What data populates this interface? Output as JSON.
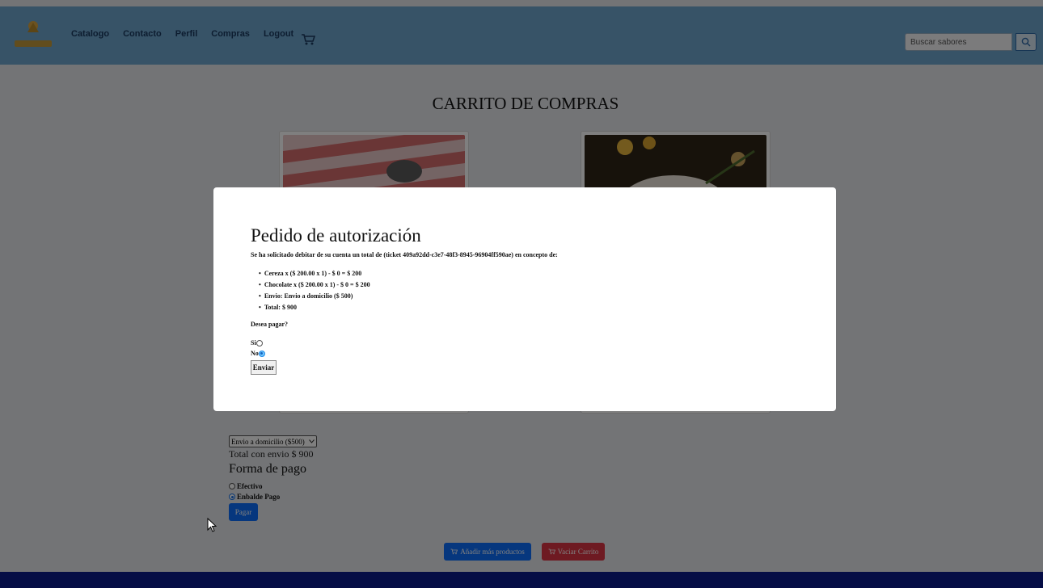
{
  "navbar": {
    "links": [
      "Catalogo",
      "Contacto",
      "Perfil",
      "Compras",
      "Logout"
    ],
    "cart_icon": "shopping-cart-icon",
    "search_placeholder": "Buscar sabores",
    "search_icon": "search-icon",
    "bg_color": "#6fa7cf"
  },
  "page": {
    "title": "CARRITO DE COMPRAS",
    "shipping_selected": "Envio a domicilio ($500)",
    "total_con_envio": "Total con envio $ 900",
    "forma_pago_title": "Forma de pago",
    "payment_options": [
      {
        "label": "Efectivo",
        "checked": false
      },
      {
        "label": "Enbalde Pago",
        "checked": true
      }
    ],
    "pagar_label": "Pagar",
    "add_more_label": "Añadir más productos",
    "empty_cart_label": "Vaciar Carrito"
  },
  "modal": {
    "title": "Pedido de autorización",
    "description": "Se ha solicitado debitar de su cuenta un total de (ticket 409a92dd-c3e7-48f3-8945-96904ff590ae) en concepto de:",
    "items": [
      "Cereza x ($ 200.00 x 1) - $ 0 = $ 200",
      "Chocolate x ($ 200.00 x 1) - $ 0 = $ 200",
      "Envio: Envio a domicilio ($ 500)",
      "Total: $ 900"
    ],
    "question": "Desea pagar?",
    "options": [
      {
        "label": "Si",
        "checked": false
      },
      {
        "label": "No",
        "checked": true
      }
    ],
    "submit_label": "Enviar"
  },
  "colors": {
    "primary": "#0d6efd",
    "danger": "#dc3545",
    "footer": "#0a1a8a"
  }
}
